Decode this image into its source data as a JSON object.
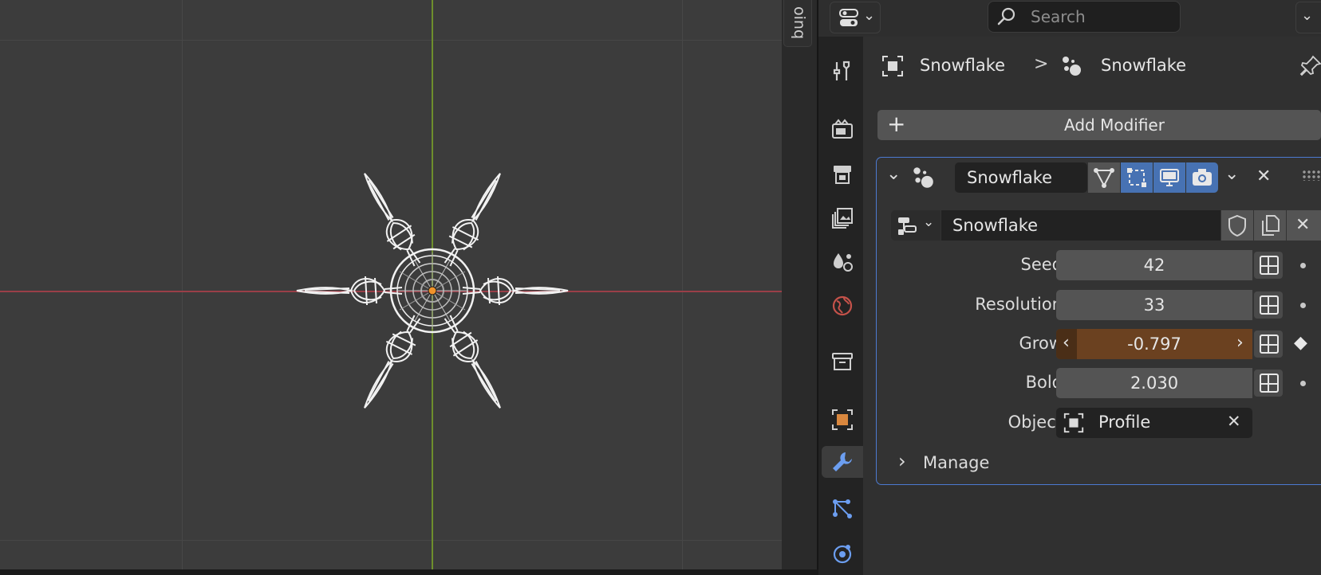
{
  "colors": {
    "axis_x": "#9a3f48",
    "axis_y": "#6e8f2c",
    "accent_blue": "#4772b3",
    "animated_orange": "#6b4120",
    "panel_bg": "#303030",
    "modifier_border": "#4c7ad1"
  },
  "viewport": {
    "side_tab_label": "oinq"
  },
  "header": {
    "search_placeholder": "Search"
  },
  "breadcrumb": {
    "object_name": "Snowflake",
    "separator": ">",
    "modifier_name": "Snowflake"
  },
  "tabs": [
    "tool-icon",
    "render-icon",
    "output-icon",
    "view-layer-icon",
    "scene-icon",
    "world-icon",
    "collection-icon",
    "object-icon",
    "modifier-icon",
    "particles-icon",
    "physics-icon"
  ],
  "add_modifier": {
    "plus": "+",
    "label": "Add Modifier"
  },
  "modifier": {
    "name": "Snowflake",
    "node_group": "Snowflake",
    "inputs": [
      {
        "label": "Seed",
        "value": "42"
      },
      {
        "label": "Resolution",
        "value": "33"
      },
      {
        "label": "Grow",
        "value": "-0.797"
      },
      {
        "label": "Bold",
        "value": "2.030"
      }
    ],
    "object_label": "Object",
    "object_value": "Profile",
    "manage_label": "Manage"
  },
  "glyphs": {
    "chevron_down": "⌄",
    "chevron_right": "›",
    "chevron_left": "‹",
    "close": "✕",
    "keyframe": "◆"
  }
}
